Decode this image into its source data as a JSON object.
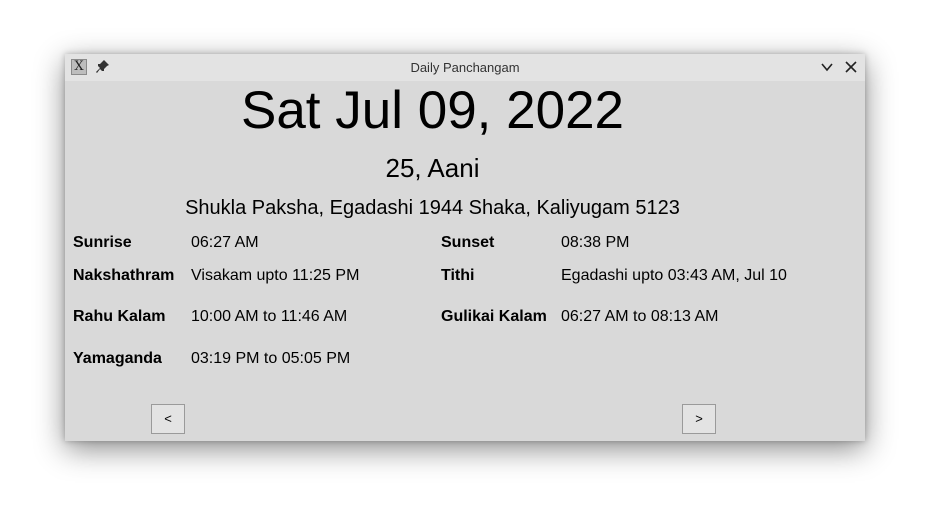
{
  "window": {
    "title": "Daily Panchangam",
    "app_icon_glyph": "X",
    "icons": [
      "app-icon",
      "pin-icon",
      "chevron-down-icon",
      "close-icon"
    ]
  },
  "header": {
    "date": "Sat Jul 09, 2022",
    "tamil_date": "25, Aani",
    "paksha_line": "Shukla Paksha, Egadashi 1944 Shaka, Kaliyugam 5123"
  },
  "details": {
    "sunrise": {
      "label": "Sunrise",
      "value": "06:27 AM"
    },
    "sunset": {
      "label": "Sunset",
      "value": "08:38 PM"
    },
    "nakshathram": {
      "label": "Nakshathram",
      "value": "Visakam upto 11:25 PM"
    },
    "tithi": {
      "label": "Tithi",
      "value": "Egadashi upto 03:43 AM, Jul 10"
    },
    "rahu_kalam": {
      "label": "Rahu Kalam",
      "value": "10:00 AM to 11:46 AM"
    },
    "gulikai_kalam": {
      "label": "Gulikai Kalam",
      "value": "06:27 AM to 08:13 AM"
    },
    "yamaganda": {
      "label": "Yamaganda",
      "value": "03:19 PM to 05:05 PM"
    }
  },
  "nav": {
    "prev_label": "<",
    "next_label": ">"
  }
}
